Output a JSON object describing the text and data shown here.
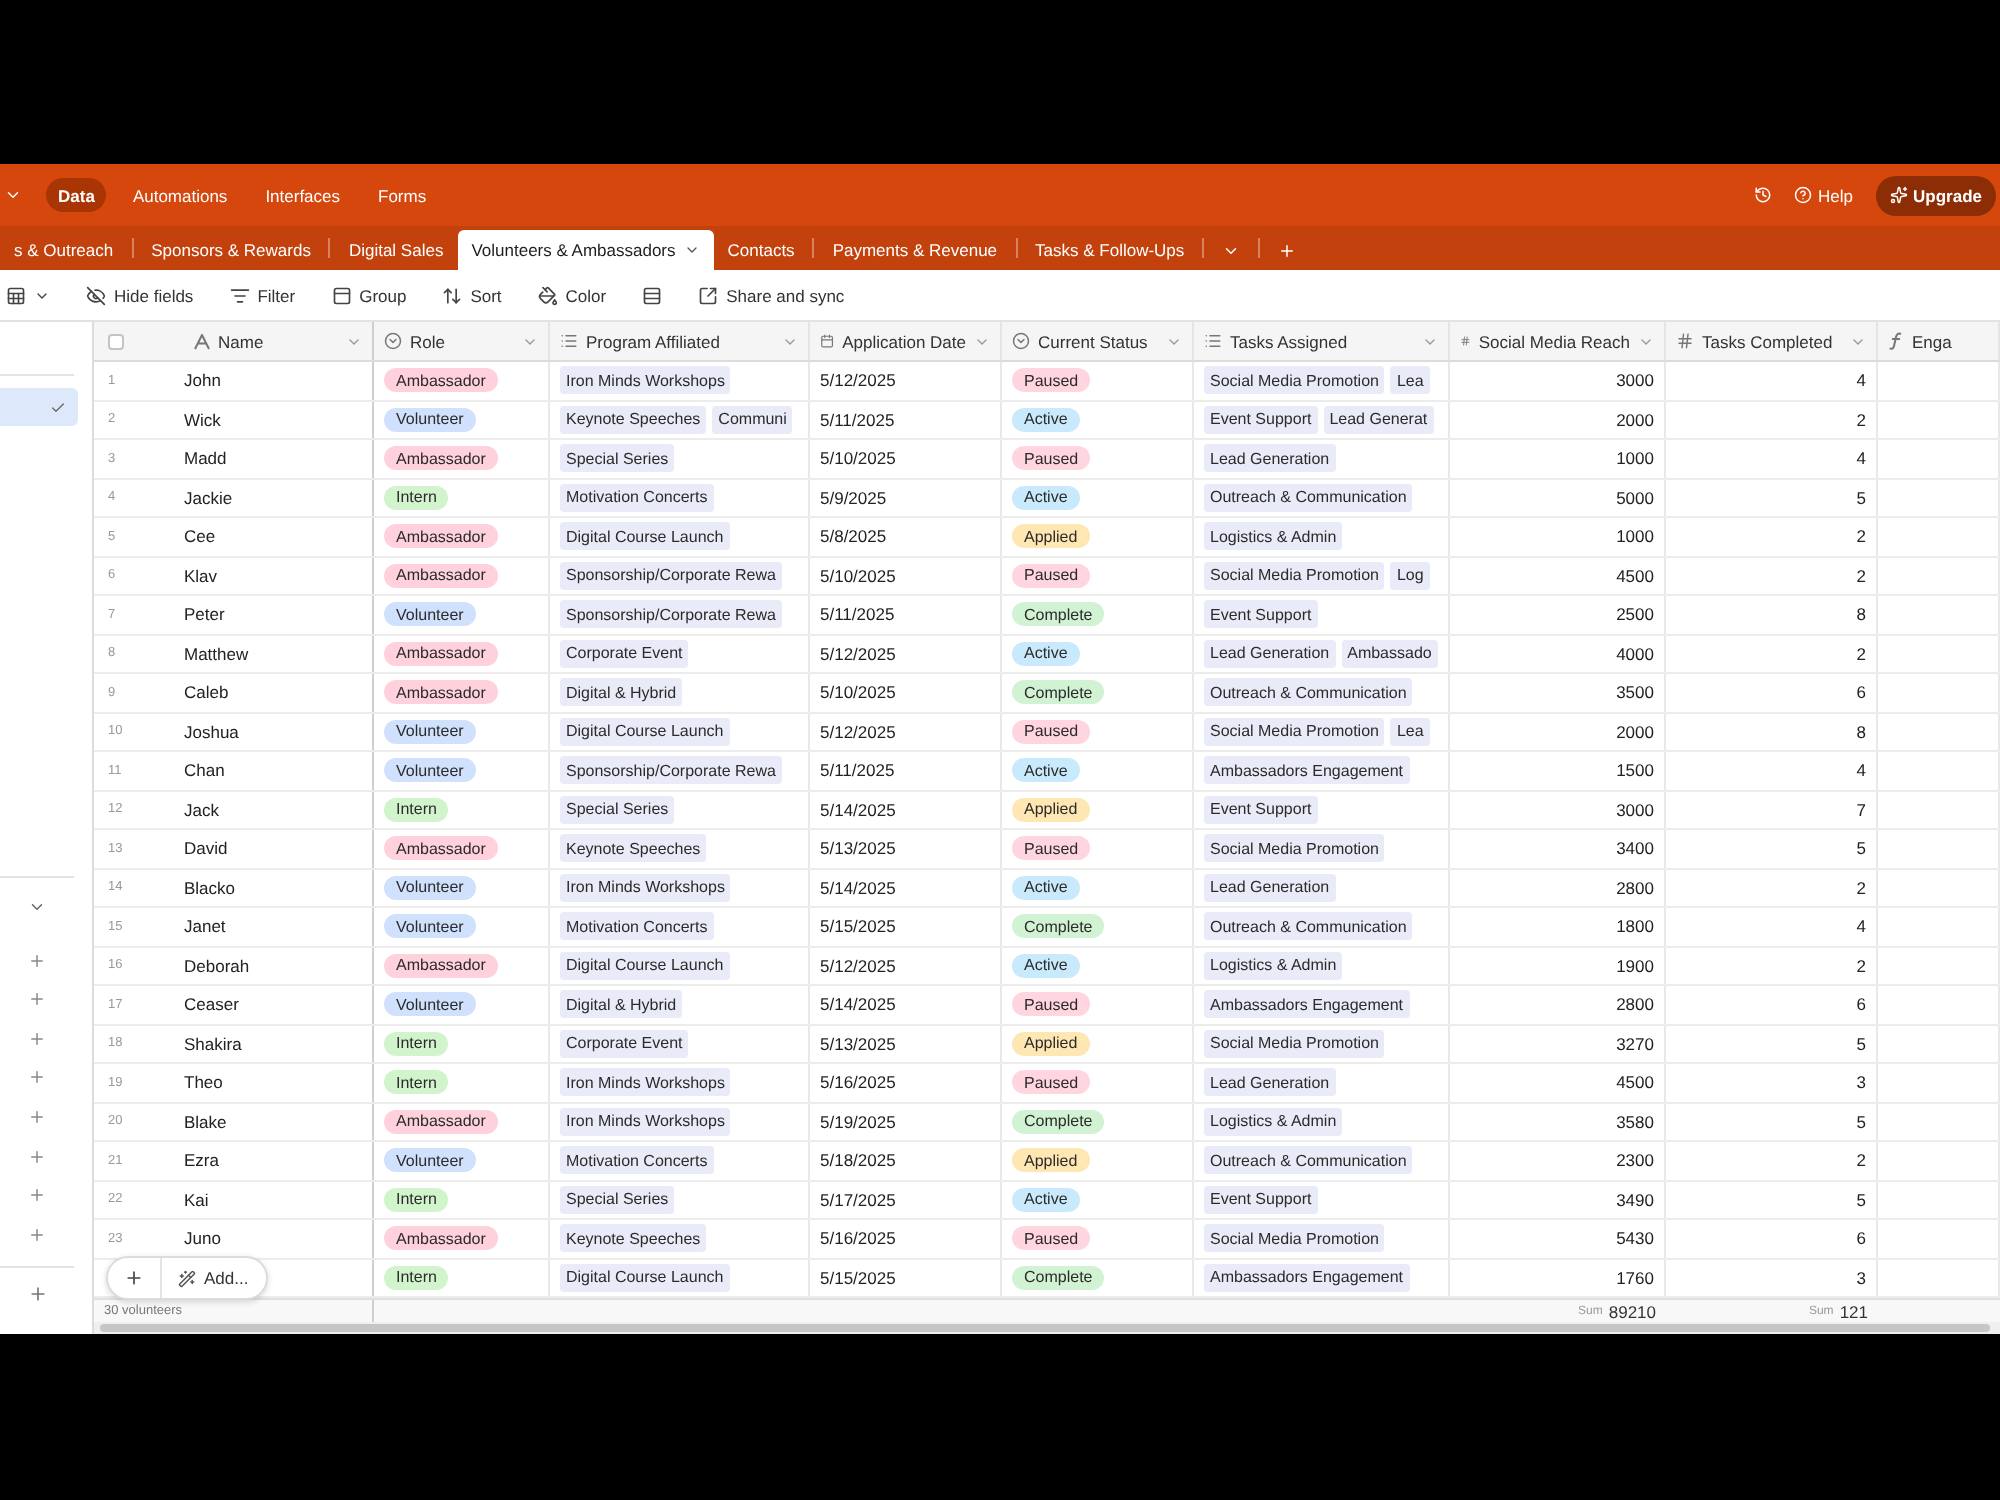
{
  "app_header": {
    "menu": [
      {
        "label": "Data",
        "selected": true
      },
      {
        "label": "Automations",
        "selected": false
      },
      {
        "label": "Interfaces",
        "selected": false
      },
      {
        "label": "Forms",
        "selected": false
      }
    ],
    "help": "Help",
    "upgrade": "Upgrade"
  },
  "tables_bar": {
    "tabs": [
      {
        "label": "s & Outreach",
        "selected": false
      },
      {
        "label": "Sponsors & Rewards",
        "selected": false
      },
      {
        "label": "Digital Sales",
        "selected": false
      },
      {
        "label": "Volunteers & Ambassadors",
        "selected": true
      },
      {
        "label": "Contacts",
        "selected": false
      },
      {
        "label": "Payments & Revenue",
        "selected": false
      },
      {
        "label": "Tasks & Follow-Ups",
        "selected": false
      }
    ]
  },
  "toolbar": {
    "items": [
      {
        "kind": "view"
      },
      {
        "kind": "hide_fields",
        "label": "Hide fields"
      },
      {
        "kind": "filter",
        "label": "Filter"
      },
      {
        "kind": "group",
        "label": "Group"
      },
      {
        "kind": "sort",
        "label": "Sort"
      },
      {
        "kind": "color",
        "label": "Color"
      },
      {
        "kind": "row_height"
      },
      {
        "kind": "share",
        "label": "Share and sync"
      }
    ]
  },
  "sidebar": {
    "views": [
      {
        "selected": true
      }
    ]
  },
  "table": {
    "select_all": {
      "checked": false
    },
    "columns": [
      {
        "label": "Name",
        "kind": "text"
      },
      {
        "label": "Role",
        "kind": "select"
      },
      {
        "label": "Program Affiliated",
        "kind": "link"
      },
      {
        "label": "Application Date",
        "kind": "date"
      },
      {
        "label": "Current Status",
        "kind": "select"
      },
      {
        "label": "Tasks Assigned",
        "kind": "link"
      },
      {
        "label": "Social Media Reach",
        "kind": "number",
        "summary": {
          "label": "Sum",
          "value": "89210"
        }
      },
      {
        "label": "Tasks Completed",
        "kind": "number",
        "summary": {
          "label": "Sum",
          "value": "121"
        }
      },
      {
        "label": "Enga",
        "kind": "formula"
      }
    ],
    "rows": [
      {
        "number": "1",
        "name": "John",
        "role": {
          "label": "Ambassador",
          "color": "#ffd1dc"
        },
        "program_affiliated": [
          "Iron Minds Workshops"
        ],
        "application_date": "5/12/2025",
        "current_status": {
          "label": "Paused",
          "color": "#ffd6e0"
        },
        "tasks_assigned": [
          "Social Media Promotion",
          "Lea"
        ],
        "social_media_reach": "3000",
        "tasks_completed": "4"
      },
      {
        "number": "2",
        "name": "Wick",
        "role": {
          "label": "Volunteer",
          "color": "#d0e1fd"
        },
        "program_affiliated": [
          "Keynote Speeches",
          "Communi"
        ],
        "application_date": "5/11/2025",
        "current_status": {
          "label": "Active",
          "color": "#c9eafc"
        },
        "tasks_assigned": [
          "Event Support",
          "Lead Generat"
        ],
        "social_media_reach": "2000",
        "tasks_completed": "2"
      },
      {
        "number": "3",
        "name": "Madd",
        "role": {
          "label": "Ambassador",
          "color": "#ffd1dc"
        },
        "program_affiliated": [
          "Special Series"
        ],
        "application_date": "5/10/2025",
        "current_status": {
          "label": "Paused",
          "color": "#ffd6e0"
        },
        "tasks_assigned": [
          "Lead Generation"
        ],
        "social_media_reach": "1000",
        "tasks_completed": "4"
      },
      {
        "number": "4",
        "name": "Jackie",
        "role": {
          "label": "Intern",
          "color": "#d2f4cd"
        },
        "program_affiliated": [
          "Motivation Concerts"
        ],
        "application_date": "5/9/2025",
        "current_status": {
          "label": "Active",
          "color": "#c9eafc"
        },
        "tasks_assigned": [
          "Outreach & Communication"
        ],
        "social_media_reach": "5000",
        "tasks_completed": "5"
      },
      {
        "number": "5",
        "name": "Cee",
        "role": {
          "label": "Ambassador",
          "color": "#ffd1dc"
        },
        "program_affiliated": [
          "Digital Course Launch"
        ],
        "application_date": "5/8/2025",
        "current_status": {
          "label": "Applied",
          "color": "#ffe7b3"
        },
        "tasks_assigned": [
          "Logistics & Admin"
        ],
        "social_media_reach": "1000",
        "tasks_completed": "2"
      },
      {
        "number": "6",
        "name": "Klav",
        "role": {
          "label": "Ambassador",
          "color": "#ffd1dc"
        },
        "program_affiliated": [
          "Sponsorship/Corporate Rewa"
        ],
        "application_date": "5/10/2025",
        "current_status": {
          "label": "Paused",
          "color": "#ffd6e0"
        },
        "tasks_assigned": [
          "Social Media Promotion",
          "Log"
        ],
        "social_media_reach": "4500",
        "tasks_completed": "2"
      },
      {
        "number": "7",
        "name": "Peter",
        "role": {
          "label": "Volunteer",
          "color": "#d0e1fd"
        },
        "program_affiliated": [
          "Sponsorship/Corporate Rewa"
        ],
        "application_date": "5/11/2025",
        "current_status": {
          "label": "Complete",
          "color": "#d1f3d3"
        },
        "tasks_assigned": [
          "Event Support"
        ],
        "social_media_reach": "2500",
        "tasks_completed": "8"
      },
      {
        "number": "8",
        "name": "Matthew",
        "role": {
          "label": "Ambassador",
          "color": "#ffd1dc"
        },
        "program_affiliated": [
          "Corporate Event"
        ],
        "application_date": "5/12/2025",
        "current_status": {
          "label": "Active",
          "color": "#c9eafc"
        },
        "tasks_assigned": [
          "Lead Generation",
          "Ambassado"
        ],
        "social_media_reach": "4000",
        "tasks_completed": "2"
      },
      {
        "number": "9",
        "name": "Caleb",
        "role": {
          "label": "Ambassador",
          "color": "#ffd1dc"
        },
        "program_affiliated": [
          "Digital & Hybrid"
        ],
        "application_date": "5/10/2025",
        "current_status": {
          "label": "Complete",
          "color": "#d1f3d3"
        },
        "tasks_assigned": [
          "Outreach & Communication"
        ],
        "social_media_reach": "3500",
        "tasks_completed": "6"
      },
      {
        "number": "10",
        "name": "Joshua",
        "role": {
          "label": "Volunteer",
          "color": "#d0e1fd"
        },
        "program_affiliated": [
          "Digital Course Launch"
        ],
        "application_date": "5/12/2025",
        "current_status": {
          "label": "Paused",
          "color": "#ffd6e0"
        },
        "tasks_assigned": [
          "Social Media Promotion",
          "Lea"
        ],
        "social_media_reach": "2000",
        "tasks_completed": "8"
      },
      {
        "number": "11",
        "name": "Chan",
        "role": {
          "label": "Volunteer",
          "color": "#d0e1fd"
        },
        "program_affiliated": [
          "Sponsorship/Corporate Rewa"
        ],
        "application_date": "5/11/2025",
        "current_status": {
          "label": "Active",
          "color": "#c9eafc"
        },
        "tasks_assigned": [
          "Ambassadors Engagement"
        ],
        "social_media_reach": "1500",
        "tasks_completed": "4"
      },
      {
        "number": "12",
        "name": "Jack",
        "role": {
          "label": "Intern",
          "color": "#d2f4cd"
        },
        "program_affiliated": [
          "Special Series"
        ],
        "application_date": "5/14/2025",
        "current_status": {
          "label": "Applied",
          "color": "#ffe7b3"
        },
        "tasks_assigned": [
          "Event Support"
        ],
        "social_media_reach": "3000",
        "tasks_completed": "7"
      },
      {
        "number": "13",
        "name": "David",
        "role": {
          "label": "Ambassador",
          "color": "#ffd1dc"
        },
        "program_affiliated": [
          "Keynote Speeches"
        ],
        "application_date": "5/13/2025",
        "current_status": {
          "label": "Paused",
          "color": "#ffd6e0"
        },
        "tasks_assigned": [
          "Social Media Promotion"
        ],
        "social_media_reach": "3400",
        "tasks_completed": "5"
      },
      {
        "number": "14",
        "name": "Blacko",
        "role": {
          "label": "Volunteer",
          "color": "#d0e1fd"
        },
        "program_affiliated": [
          "Iron Minds Workshops"
        ],
        "application_date": "5/14/2025",
        "current_status": {
          "label": "Active",
          "color": "#c9eafc"
        },
        "tasks_assigned": [
          "Lead Generation"
        ],
        "social_media_reach": "2800",
        "tasks_completed": "2"
      },
      {
        "number": "15",
        "name": "Janet",
        "role": {
          "label": "Volunteer",
          "color": "#d0e1fd"
        },
        "program_affiliated": [
          "Motivation Concerts"
        ],
        "application_date": "5/15/2025",
        "current_status": {
          "label": "Complete",
          "color": "#d1f3d3"
        },
        "tasks_assigned": [
          "Outreach & Communication"
        ],
        "social_media_reach": "1800",
        "tasks_completed": "4"
      },
      {
        "number": "16",
        "name": "Deborah",
        "role": {
          "label": "Ambassador",
          "color": "#ffd1dc"
        },
        "program_affiliated": [
          "Digital Course Launch"
        ],
        "application_date": "5/12/2025",
        "current_status": {
          "label": "Active",
          "color": "#c9eafc"
        },
        "tasks_assigned": [
          "Logistics & Admin"
        ],
        "social_media_reach": "1900",
        "tasks_completed": "2"
      },
      {
        "number": "17",
        "name": "Ceaser",
        "role": {
          "label": "Volunteer",
          "color": "#d0e1fd"
        },
        "program_affiliated": [
          "Digital & Hybrid"
        ],
        "application_date": "5/14/2025",
        "current_status": {
          "label": "Paused",
          "color": "#ffd6e0"
        },
        "tasks_assigned": [
          "Ambassadors Engagement"
        ],
        "social_media_reach": "2800",
        "tasks_completed": "6"
      },
      {
        "number": "18",
        "name": "Shakira",
        "role": {
          "label": "Intern",
          "color": "#d2f4cd"
        },
        "program_affiliated": [
          "Corporate Event"
        ],
        "application_date": "5/13/2025",
        "current_status": {
          "label": "Applied",
          "color": "#ffe7b3"
        },
        "tasks_assigned": [
          "Social Media Promotion"
        ],
        "social_media_reach": "3270",
        "tasks_completed": "5"
      },
      {
        "number": "19",
        "name": "Theo",
        "role": {
          "label": "Intern",
          "color": "#d2f4cd"
        },
        "program_affiliated": [
          "Iron Minds Workshops"
        ],
        "application_date": "5/16/2025",
        "current_status": {
          "label": "Paused",
          "color": "#ffd6e0"
        },
        "tasks_assigned": [
          "Lead Generation"
        ],
        "social_media_reach": "4500",
        "tasks_completed": "3"
      },
      {
        "number": "20",
        "name": "Blake",
        "role": {
          "label": "Ambassador",
          "color": "#ffd1dc"
        },
        "program_affiliated": [
          "Iron Minds Workshops"
        ],
        "application_date": "5/19/2025",
        "current_status": {
          "label": "Complete",
          "color": "#d1f3d3"
        },
        "tasks_assigned": [
          "Logistics & Admin"
        ],
        "social_media_reach": "3580",
        "tasks_completed": "5"
      },
      {
        "number": "21",
        "name": "Ezra",
        "role": {
          "label": "Volunteer",
          "color": "#d0e1fd"
        },
        "program_affiliated": [
          "Motivation Concerts"
        ],
        "application_date": "5/18/2025",
        "current_status": {
          "label": "Applied",
          "color": "#ffe7b3"
        },
        "tasks_assigned": [
          "Outreach & Communication"
        ],
        "social_media_reach": "2300",
        "tasks_completed": "2"
      },
      {
        "number": "22",
        "name": "Kai",
        "role": {
          "label": "Intern",
          "color": "#d2f4cd"
        },
        "program_affiliated": [
          "Special Series"
        ],
        "application_date": "5/17/2025",
        "current_status": {
          "label": "Active",
          "color": "#c9eafc"
        },
        "tasks_assigned": [
          "Event Support"
        ],
        "social_media_reach": "3490",
        "tasks_completed": "5"
      },
      {
        "number": "23",
        "name": "Juno",
        "role": {
          "label": "Ambassador",
          "color": "#ffd1dc"
        },
        "program_affiliated": [
          "Keynote Speeches"
        ],
        "application_date": "5/16/2025",
        "current_status": {
          "label": "Paused",
          "color": "#ffd6e0"
        },
        "tasks_assigned": [
          "Social Media Promotion"
        ],
        "social_media_reach": "5430",
        "tasks_completed": "6"
      },
      {
        "role": {
          "label": "Intern",
          "color": "#d2f4cd"
        },
        "program_affiliated": [
          "Digital Course Launch"
        ],
        "application_date": "5/15/2025",
        "current_status": {
          "label": "Complete",
          "color": "#d1f3d3"
        },
        "tasks_assigned": [
          "Ambassadors Engagement"
        ],
        "social_media_reach": "1760",
        "tasks_completed": "3"
      }
    ],
    "record_count": "30 volunteers",
    "add_button": "Add..."
  }
}
